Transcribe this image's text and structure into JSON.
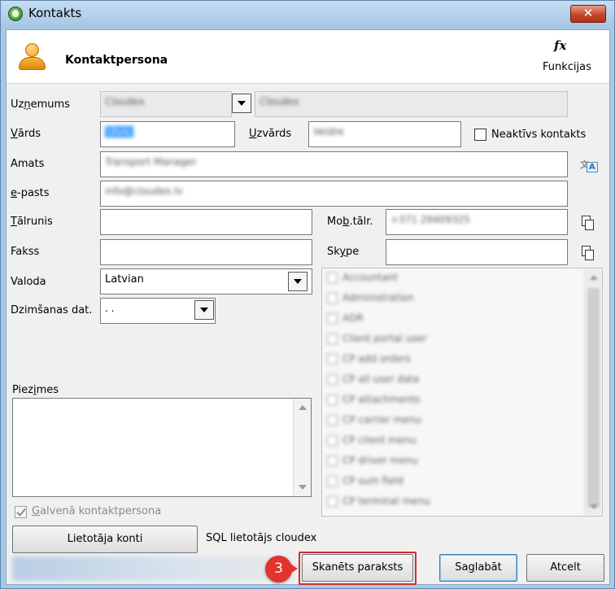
{
  "window": {
    "title": "Kontakts",
    "close_glyph": "✕"
  },
  "header": {
    "title": "Kontaktpersona",
    "functions_icon": "fx",
    "functions_label": "Funkcijas"
  },
  "labels": {
    "company_prefix": "Uz",
    "company_key": "ņ",
    "company_suffix": "emums",
    "first_name_key": "V",
    "first_name_rest": "ārds",
    "last_name_key": "U",
    "last_name_rest": "zvārds",
    "inactive": "Neaktīvs kontakts",
    "position": "Amats",
    "email_key": "e",
    "email_rest": "-pasts",
    "phone_key": "T",
    "phone_rest": "ālrunis",
    "mobile_prefix": "Mo",
    "mobile_key": "b",
    "mobile_suffix": ".tālr.",
    "fax": "Fakss",
    "skype_prefix": "Sk",
    "skype_key": "y",
    "skype_suffix": "pe",
    "language": "Valoda",
    "birth_date": "Dzimšanas dat.",
    "notes_prefix": "Piez",
    "notes_key": "i",
    "notes_suffix": "mes",
    "main_contact_key": "G",
    "main_contact_rest": "alvenā kontaktpersona",
    "sql_user": "SQL lietotājs cloudex"
  },
  "fields": {
    "company_code": "Cloudex",
    "company_name": "Cloudex",
    "first_name": "Ulvis",
    "last_name": "Veldre",
    "position": "Transport Manager",
    "email": "info@cloudex.lv",
    "phone": "",
    "mobile": "+371 29409325",
    "fax": "",
    "skype": "",
    "language": "Latvian",
    "birth_date": " .  .",
    "notes": ""
  },
  "checkboxes": {
    "inactive": false,
    "main_contact": true
  },
  "roles": [
    "Accountant",
    "Administration",
    "ADR",
    "Client portal user",
    "CP add orders",
    "CP all user data",
    "CP attachments",
    "CP carrier menu",
    "CP client menu",
    "CP driver menu",
    "CP sum field",
    "CP terminal menu"
  ],
  "buttons": {
    "user_accounts": "Lietotāja konti",
    "scanned_signature": "Skanēts paraksts",
    "save_key": "g",
    "save_prefix": "Sa",
    "save_suffix": "labāt",
    "cancel": "Atcelt"
  },
  "annotation": {
    "step": "3",
    "color": "#e2332e"
  },
  "icons": {
    "app": "app-leaf-icon",
    "person": "person-icon",
    "functions": "fx-icon",
    "translate": "translate-icon",
    "copy": "copy-icon",
    "dropdown": "chevron-down-icon"
  }
}
